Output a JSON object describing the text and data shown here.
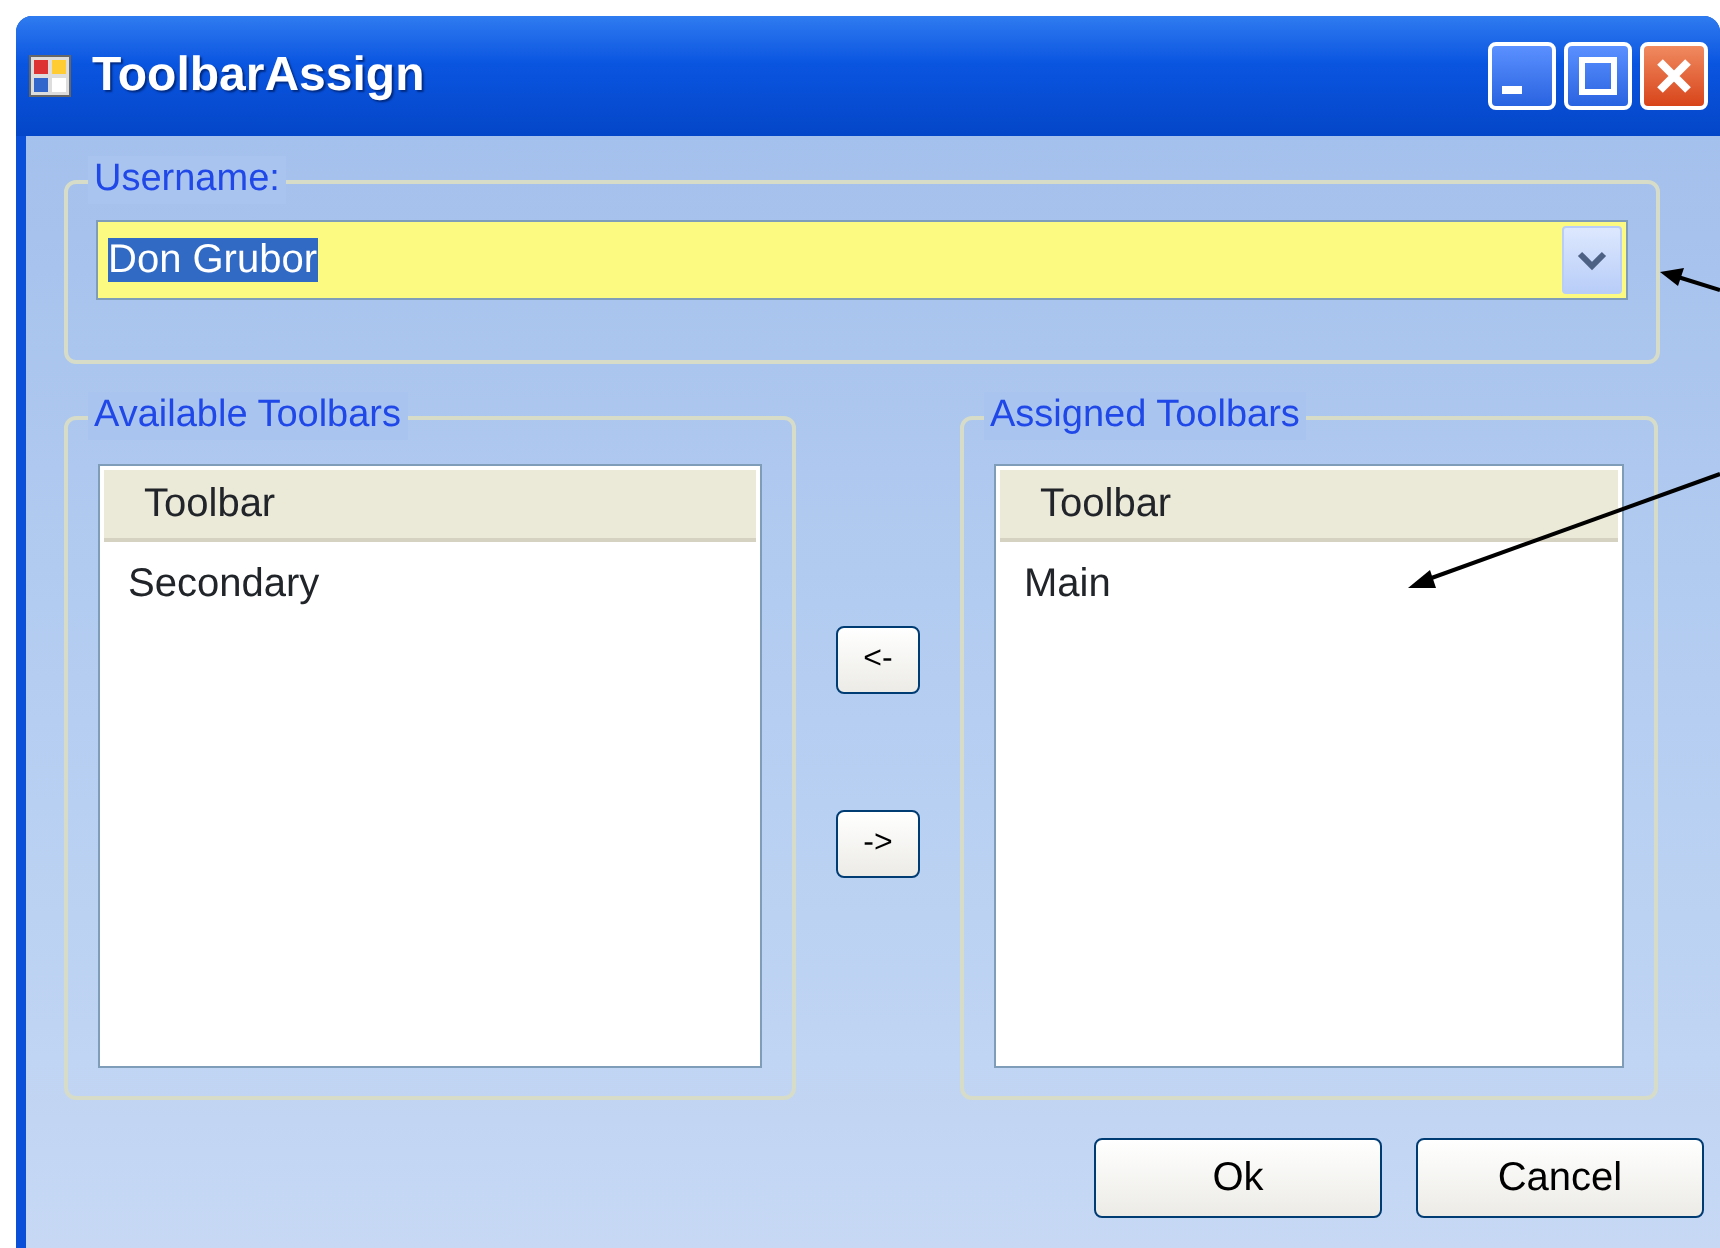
{
  "window": {
    "title": "ToolbarAssign"
  },
  "username": {
    "label": "Username:",
    "value": "Don Grubor",
    "value_selected": true
  },
  "lists": [
    {
      "title": "Available Toolbars",
      "column": "Toolbar",
      "items": [
        "Secondary"
      ]
    },
    {
      "title": "Assigned Toolbars",
      "column": "Toolbar",
      "items": [
        "Main"
      ]
    }
  ],
  "move_buttons": [
    "<-",
    "->"
  ],
  "buttons": [
    "Ok",
    "Cancel"
  ]
}
